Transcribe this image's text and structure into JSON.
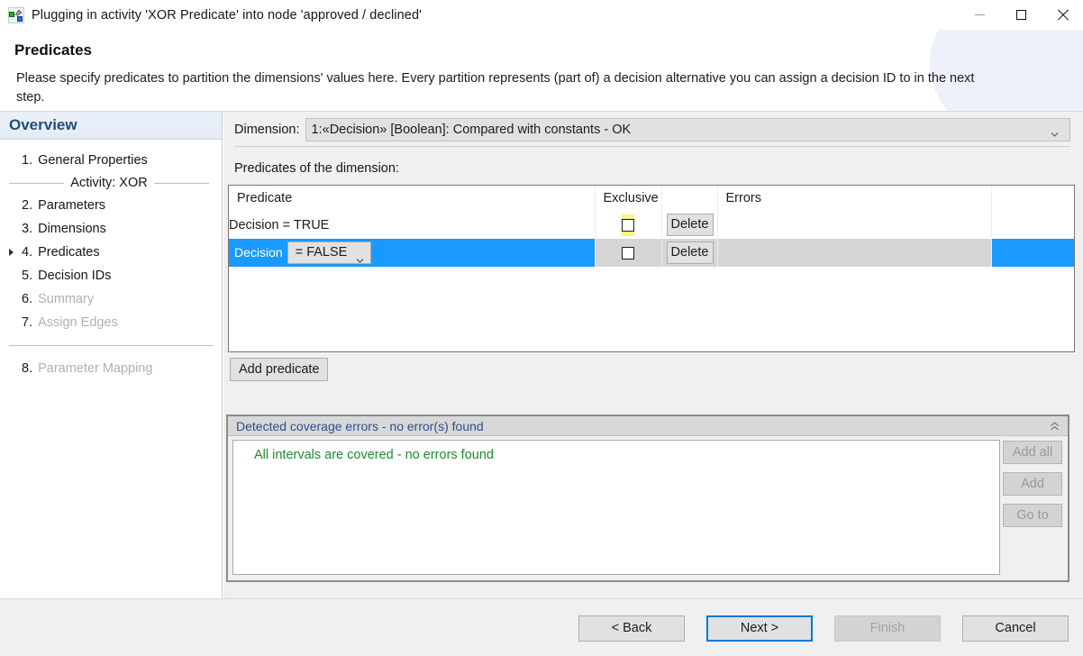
{
  "window": {
    "icon": "plug-activity-icon",
    "title": "Plugging in activity 'XOR Predicate' into node 'approved / declined'",
    "minimize": "minimize-icon",
    "maximize": "maximize-icon",
    "close": "close-icon"
  },
  "banner": {
    "title": "Predicates",
    "description": "Please specify predicates to partition the dimensions' values here. Every partition represents (part of) a decision alternative you can assign a decision ID to in the next step."
  },
  "sidebar": {
    "header": "Overview",
    "items": [
      {
        "num": "1.",
        "label": "General Properties",
        "state": "enabled"
      },
      {
        "num": "2.",
        "label": "Parameters",
        "state": "enabled"
      },
      {
        "num": "3.",
        "label": "Dimensions",
        "state": "enabled"
      },
      {
        "num": "4.",
        "label": "Predicates",
        "state": "current"
      },
      {
        "num": "5.",
        "label": "Decision IDs",
        "state": "enabled"
      },
      {
        "num": "6.",
        "label": "Summary",
        "state": "disabled"
      },
      {
        "num": "7.",
        "label": "Assign Edges",
        "state": "disabled"
      },
      {
        "num": "8.",
        "label": "Parameter Mapping",
        "state": "disabled"
      }
    ],
    "group_label": "Activity: XOR"
  },
  "main": {
    "dimension_label": "Dimension:",
    "dimension_value": "1:«Decision» [Boolean]: Compared with constants  -  OK",
    "predicates_label": "Predicates of the dimension:",
    "table": {
      "columns": [
        "Predicate",
        "Exclusive",
        "",
        "Errors",
        ""
      ],
      "rows": [
        {
          "predicate": "Decision = TRUE",
          "exclusive": false,
          "exclusive_highlight": true,
          "delete_label": "Delete",
          "errors": "",
          "selected": false
        },
        {
          "predicate_field": "Decision",
          "predicate_operator": "= FALSE",
          "exclusive": false,
          "exclusive_highlight": false,
          "delete_label": "Delete",
          "errors": "",
          "selected": true
        }
      ]
    },
    "add_predicate_label": "Add predicate"
  },
  "errors_panel": {
    "header": "Detected coverage errors - no error(s) found",
    "collapse_icon": "collapse-chevron-icon",
    "message": "All intervals are covered - no errors found",
    "buttons": [
      {
        "label": "Add all",
        "enabled": false
      },
      {
        "label": "Add",
        "enabled": false
      },
      {
        "label": "Go to",
        "enabled": false
      }
    ]
  },
  "footer": {
    "buttons": [
      {
        "label": "< Back",
        "style": "normal"
      },
      {
        "label": "Next >",
        "style": "primary"
      },
      {
        "label": "Finish",
        "style": "disabled"
      },
      {
        "label": "Cancel",
        "style": "normal"
      }
    ]
  },
  "colors": {
    "selection_blue": "#1a9aff",
    "accent_blue": "#0078d7",
    "header_blue": "#1f4e79",
    "success_green": "#1e8b2e",
    "highlight_yellow": "#fbf47e"
  }
}
